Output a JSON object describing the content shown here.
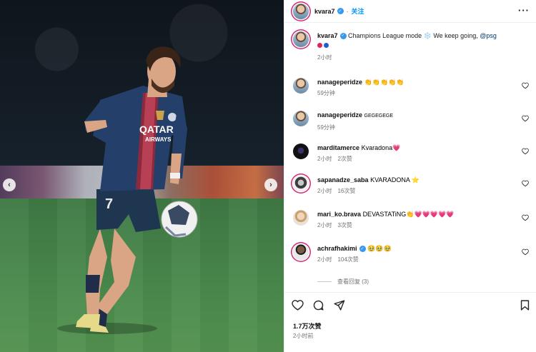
{
  "post": {
    "username": "kvara7",
    "follow_label": "关注",
    "more_label": "···",
    "dot": "·",
    "caption": {
      "username": "kvara7",
      "text": "Champions League mode ❄️ We keep going, ",
      "mention": "@psg",
      "time": "2小时"
    },
    "likes": "1.7万次赞",
    "time": "2小时前",
    "view_replies": "查看回复 (3)"
  },
  "comments": [
    {
      "username": "nanageperidze",
      "text": "👏👏👏👏👏",
      "time": "59分钟",
      "likes": ""
    },
    {
      "username": "nanageperidze",
      "text": "GEGEGEGE",
      "time": "59分钟",
      "likes": ""
    },
    {
      "username": "marditamerce",
      "text": "Kvaradona💗",
      "time": "2小时",
      "likes": "2次赞"
    },
    {
      "username": "sapanadze_saba",
      "text": "KVARADONA ⭐",
      "time": "2小时",
      "likes": "16次赞"
    },
    {
      "username": "mari_ko.brava",
      "text": "DEVASTATiNG👏💗💗💗💗💗",
      "time": "2小时",
      "likes": "3次赞"
    },
    {
      "username": "achrafhakimi",
      "text": "🥹🥹🥹",
      "time": "2小时",
      "likes": "104次赞"
    }
  ],
  "player": {
    "sponsor_line1": "QATAR",
    "sponsor_line2": "AIRWAYS",
    "number": "7"
  },
  "icons": {
    "heart": "heart-icon",
    "comment": "comment-icon",
    "share": "share-icon",
    "save": "bookmark-icon",
    "verified": "verified-badge-icon",
    "prev": "chevron-left-icon",
    "next": "chevron-right-icon"
  },
  "colors": {
    "accent": "#0095f6",
    "mention": "#00376b",
    "verified": "#3897f0",
    "muted": "#737373"
  }
}
